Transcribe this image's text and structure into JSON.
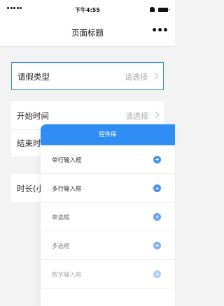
{
  "status_bar": {
    "time": "下午4:55"
  },
  "nav": {
    "title": "页面标题",
    "more": "•••"
  },
  "form": {
    "leave_type": {
      "label": "请假类型",
      "value": "请选择"
    },
    "start_time": {
      "label": "开始时间",
      "value": "请选择"
    },
    "end_time": {
      "label": "结束时间"
    },
    "duration": {
      "label": "时长(小时)"
    }
  },
  "panel": {
    "title": "控件库",
    "items": [
      {
        "label": "单行输入框"
      },
      {
        "label": "多行输入框"
      },
      {
        "label": "单选框"
      },
      {
        "label": "多选框"
      },
      {
        "label": "数字输入框"
      }
    ]
  },
  "colors": {
    "accent": "#2f8df3",
    "background": "#f3f3f3"
  }
}
